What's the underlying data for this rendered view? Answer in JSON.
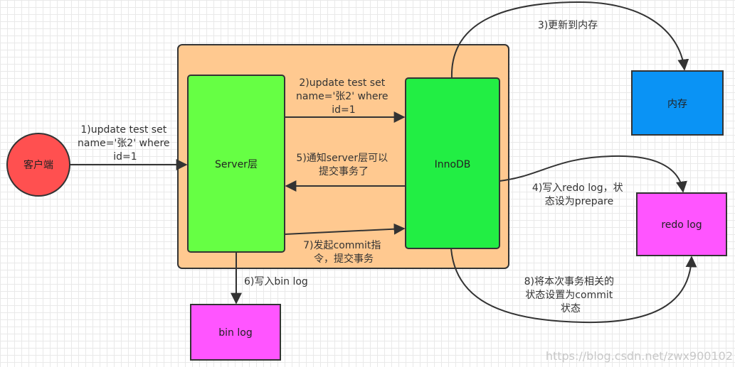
{
  "nodes": {
    "client": "客户端",
    "server": "Server层",
    "innodb": "InnoDB",
    "memory": "内存",
    "redo_log": "redo log",
    "bin_log": "bin log"
  },
  "edges": {
    "step1": [
      "1)update test set",
      "name='张2' where",
      "id=1"
    ],
    "step2": [
      "2)update test set",
      "name='张2' where",
      "id=1"
    ],
    "step3": [
      "3)更新到内存"
    ],
    "step4": [
      "4)写入redo log，状",
      "态设为prepare"
    ],
    "step5": [
      "5)通知server层可以",
      "提交事务了"
    ],
    "step6": [
      "6)写入bin log"
    ],
    "step7": [
      "7)发起commit指",
      "令，提交事务"
    ],
    "step8": [
      "8)将本次事务相关的",
      "状态设置为commit",
      "状态"
    ]
  },
  "watermark": "https://blog.csdn.net/zwx900102",
  "colors": {
    "container": "#FFC990",
    "server": "#66FF44",
    "innodb": "#22EE44",
    "memory": "#0A93F5",
    "log": "#FF55FF",
    "client": "#FF5050"
  }
}
